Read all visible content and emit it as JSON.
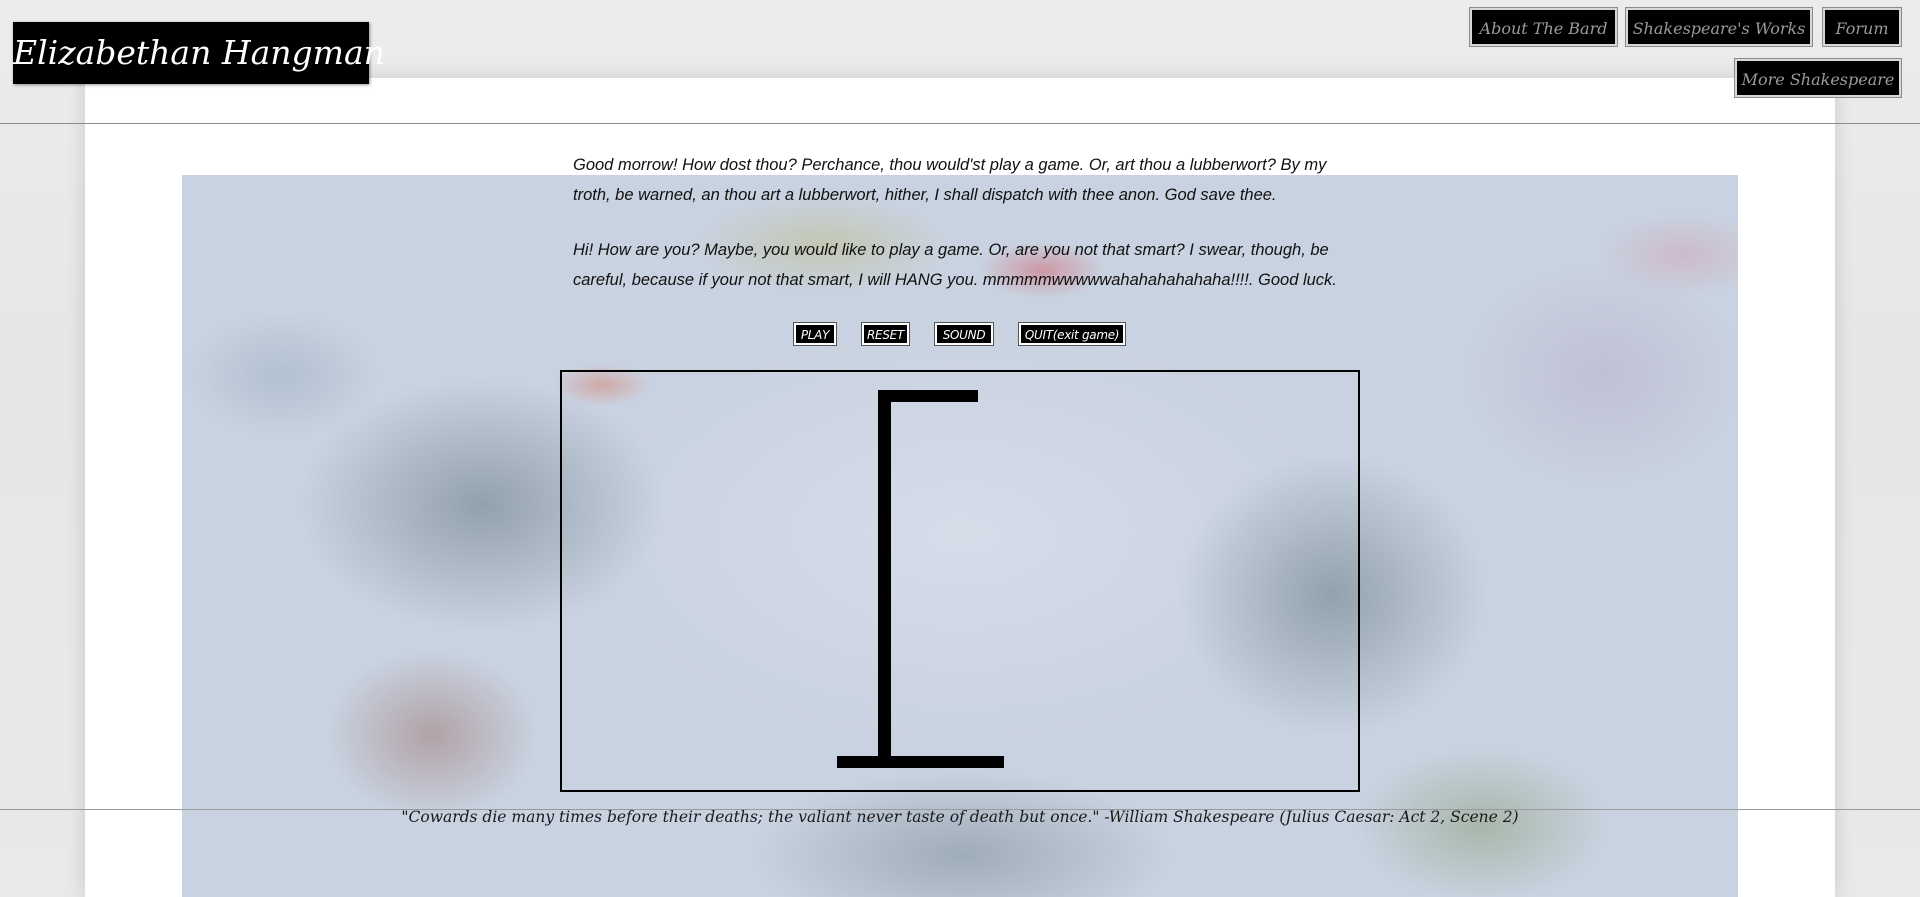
{
  "site": {
    "title": "Elizabethan Hangman"
  },
  "nav": {
    "items": [
      {
        "label": "About The Bard"
      },
      {
        "label": "Shakespeare's Works"
      },
      {
        "label": "Forum"
      },
      {
        "label": "More Shakespeare"
      }
    ]
  },
  "intro": {
    "elizabethan": "Good morrow! How dost thou? Perchance, thou would'st play a game. Or, art thou a lubberwort? By my troth, be warned, an thou art a lubberwort, hither, I shall dispatch with thee anon. God save thee.",
    "modern": "Hi! How are you? Maybe, you would like to play a game. Or, are you not that smart? I swear, though, be careful, because if your not that smart, I will HANG you. mmmmmwwwwwahahahahahaha!!!!. Good luck."
  },
  "controls": {
    "play": "PLAY",
    "reset": "RESET",
    "sound": "SOUND",
    "quit": "QUIT(exit game)"
  },
  "game": {
    "gallows_icon": "gallows-icon",
    "stroke_color": "#000000"
  },
  "footer": {
    "quote": "\"Cowards die many times before their deaths; the valiant never taste of death but once.\" -William Shakespeare (Julius Caesar: Act 2, Scene 2)"
  }
}
